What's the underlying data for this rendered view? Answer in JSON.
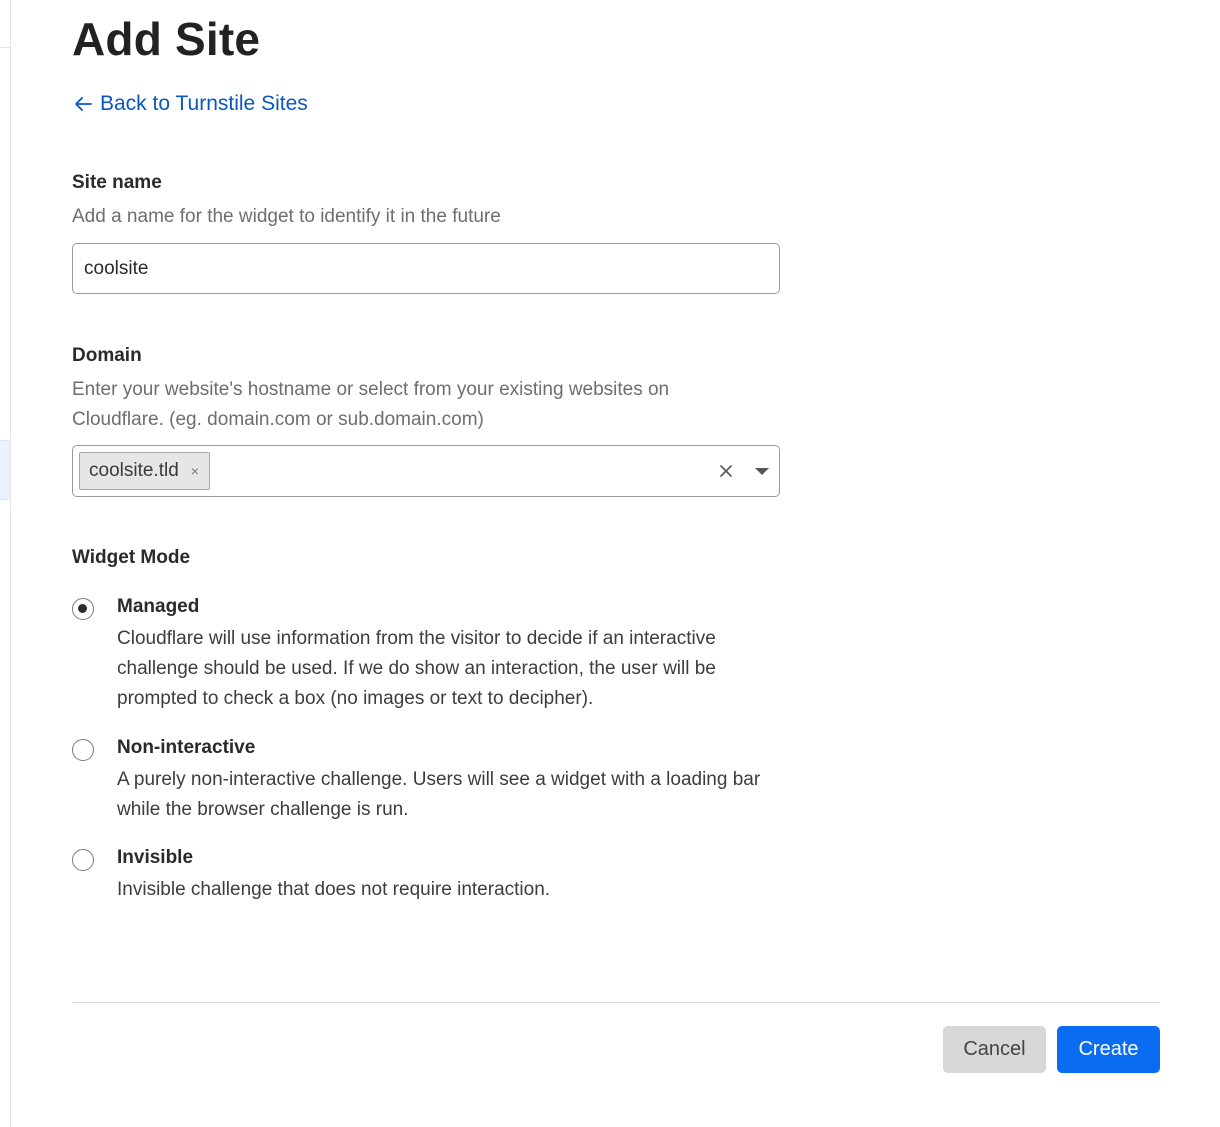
{
  "page": {
    "title": "Add Site",
    "back_link": "Back to Turnstile Sites"
  },
  "site_name": {
    "label": "Site name",
    "help": "Add a name for the widget to identify it in the future",
    "value": "coolsite"
  },
  "domain": {
    "label": "Domain",
    "help_line1": "Enter your website's hostname or select from your existing websites on",
    "help_line2": "Cloudflare. (eg. domain.com or sub.domain.com)",
    "tags": [
      "coolsite.tld"
    ],
    "tag_remove_glyph": "×"
  },
  "widget_mode": {
    "label": "Widget Mode",
    "selected": "Managed",
    "options": [
      {
        "title": "Managed",
        "description": "Cloudflare will use information from the visitor to decide if an interactive challenge should be used. If we do show an interaction, the user will be prompted to check a box (no images or text to decipher).",
        "checked": true
      },
      {
        "title": "Non-interactive",
        "description": "A purely non-interactive challenge. Users will see a widget with a loading bar while the browser challenge is run.",
        "checked": false
      },
      {
        "title": "Invisible",
        "description": "Invisible challenge that does not require interaction.",
        "checked": false
      }
    ]
  },
  "footer": {
    "cancel_label": "Cancel",
    "create_label": "Create"
  },
  "colors": {
    "link": "#0a57c2",
    "primary_button": "#0a6cf0",
    "secondary_button": "#d8d8d8"
  },
  "icons": {
    "back": "arrow-left-icon",
    "clear": "close-icon",
    "dropdown": "caret-down-icon"
  }
}
